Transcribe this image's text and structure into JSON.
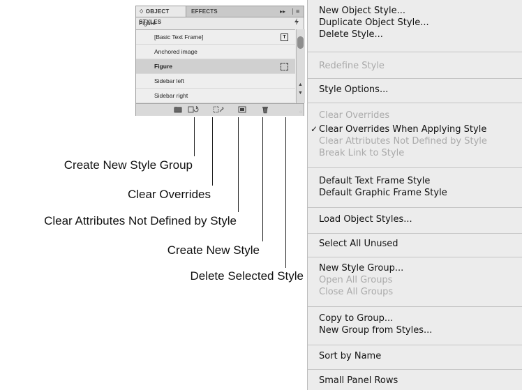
{
  "panel": {
    "tabs": {
      "active": "♢ OBJECT STYLES",
      "inactive": "EFFECTS"
    },
    "collapse_glyph": "▸▸",
    "menu_glyph": "≡",
    "current_style": "Figure",
    "styles": [
      {
        "label": "[Basic Text Frame]",
        "icon": "T"
      },
      {
        "label": "Anchored image",
        "icon": ""
      },
      {
        "label": "Figure",
        "icon": "",
        "selected": true
      },
      {
        "label": "Sidebar left",
        "icon": ""
      },
      {
        "label": "Sidebar right",
        "icon": ""
      }
    ]
  },
  "callouts": {
    "create_group": "Create New Style Group",
    "clear_overrides": "Clear Overrides",
    "clear_attributes": "Clear Attributes Not Defined by Style",
    "create_style": "Create New Style",
    "delete_style": "Delete Selected Style"
  },
  "menu": {
    "new_object_style": "New Object Style...",
    "duplicate_object_style": "Duplicate Object Style...",
    "delete_style": "Delete Style...",
    "redefine_style": "Redefine Style",
    "style_options": "Style Options...",
    "clear_overrides": "Clear Overrides",
    "clear_overrides_when_applying": "Clear Overrides When Applying Style",
    "check_glyph": "✓",
    "clear_attributes": "Clear Attributes Not Defined by Style",
    "break_link": "Break Link to Style",
    "default_text_frame": "Default Text Frame Style",
    "default_graphic_frame": "Default Graphic Frame Style",
    "submenu_arrow": "▶",
    "load_object_styles": "Load Object Styles...",
    "select_all_unused": "Select All Unused",
    "new_style_group": "New Style Group...",
    "open_all_groups": "Open All Groups",
    "close_all_groups": "Close All Groups",
    "copy_to_group": "Copy to Group...",
    "new_group_from_styles": "New Group from Styles...",
    "sort_by_name": "Sort by Name",
    "small_panel_rows": "Small Panel Rows"
  }
}
